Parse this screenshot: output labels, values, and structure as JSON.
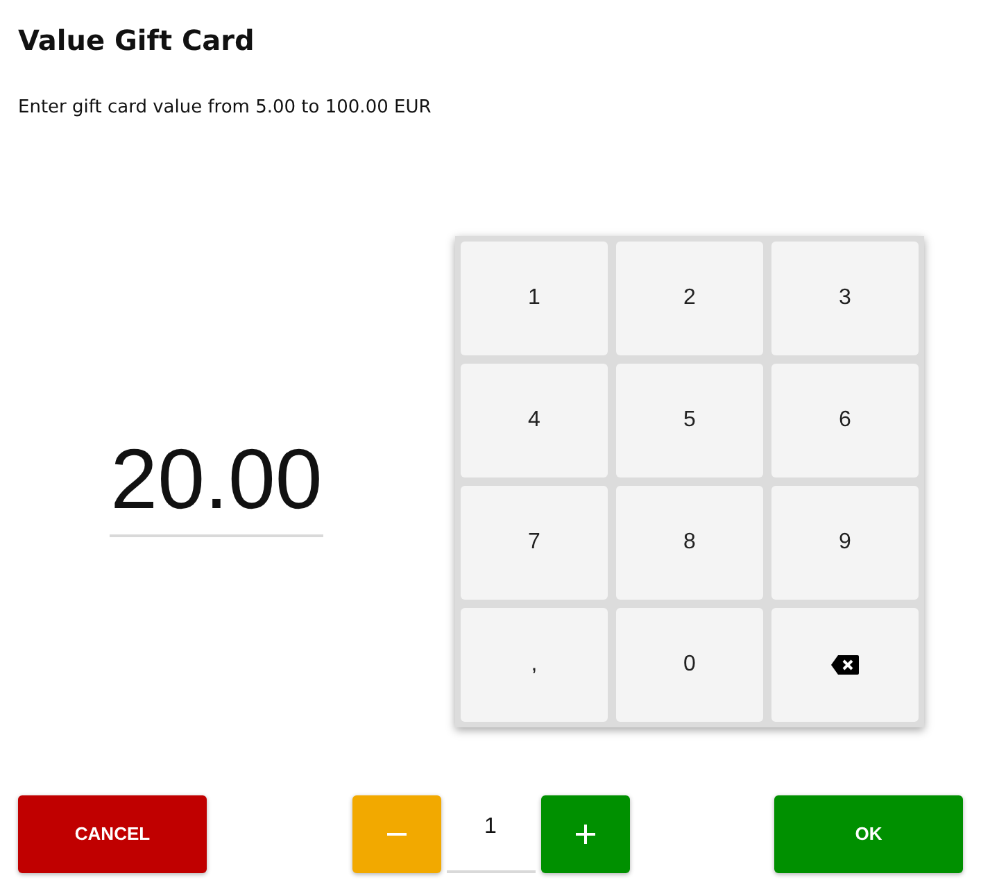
{
  "dialog": {
    "title": "Value Gift Card",
    "instruction": "Enter gift card value from 5.00 to 100.00 EUR"
  },
  "amount": {
    "value": "20.00"
  },
  "keypad": {
    "keys": [
      {
        "kind": "character",
        "label": "1"
      },
      {
        "kind": "character",
        "label": "2"
      },
      {
        "kind": "character",
        "label": "3"
      },
      {
        "kind": "character",
        "label": "4"
      },
      {
        "kind": "character",
        "label": "5"
      },
      {
        "kind": "character",
        "label": "6"
      },
      {
        "kind": "character",
        "label": "7"
      },
      {
        "kind": "character",
        "label": "8"
      },
      {
        "kind": "character",
        "label": "9"
      },
      {
        "kind": "character",
        "label": ","
      },
      {
        "kind": "character",
        "label": "0"
      },
      {
        "kind": "backspace"
      }
    ]
  },
  "quantity": {
    "value": "1"
  },
  "actions": [
    {
      "kind": "cancel",
      "label": "CANCEL"
    },
    {
      "kind": "ok",
      "label": "OK"
    }
  ]
}
